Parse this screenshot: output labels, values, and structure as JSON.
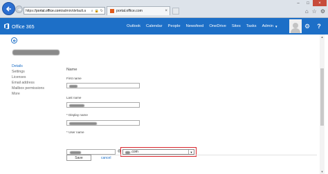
{
  "browser": {
    "address_url_prefix": "https://",
    "address_url_domain": "portal.office.com",
    "address_url_path": "/admin/default.a",
    "address_icons": [
      "search-icon",
      "lock-icon",
      "refresh-icon"
    ],
    "tab_title": "portal.office.com",
    "tab_close": "×",
    "window_minimize": "–",
    "window_maximize": "□",
    "window_close": "×",
    "tools_icons": [
      "home-icon",
      "star-icon",
      "gear-icon"
    ]
  },
  "header": {
    "brand": "Office 365",
    "brand_color": "#1d6fc7",
    "nav": {
      "outlook": "Outlook",
      "calendar": "Calendar",
      "people": "People",
      "newsfeed": "Newsfeed",
      "onedrive": "OneDrive",
      "sites": "Sites",
      "tasks": "Tasks",
      "admin": "Admin",
      "admin_caret": "▼"
    },
    "settings_icon": "⚙",
    "help_icon": "?"
  },
  "sidebar": {
    "items": [
      {
        "label": "Details",
        "active": true
      },
      {
        "label": "Settings",
        "active": false
      },
      {
        "label": "Licenses",
        "active": false
      },
      {
        "label": "Email address",
        "active": false
      },
      {
        "label": "Mailbox permissions",
        "active": false
      },
      {
        "label": "More",
        "active": false
      }
    ]
  },
  "form": {
    "section_title": "Name",
    "first_name_label": "First name",
    "last_name_label": "Last name",
    "display_name_label": "* Display name",
    "user_name_label": "* User name",
    "at_sign": "@",
    "domain_suffix": ".com",
    "domain_caret": "▼",
    "highlight_color": "#d8232a",
    "save_label": "Save",
    "cancel_label": "cancel"
  }
}
